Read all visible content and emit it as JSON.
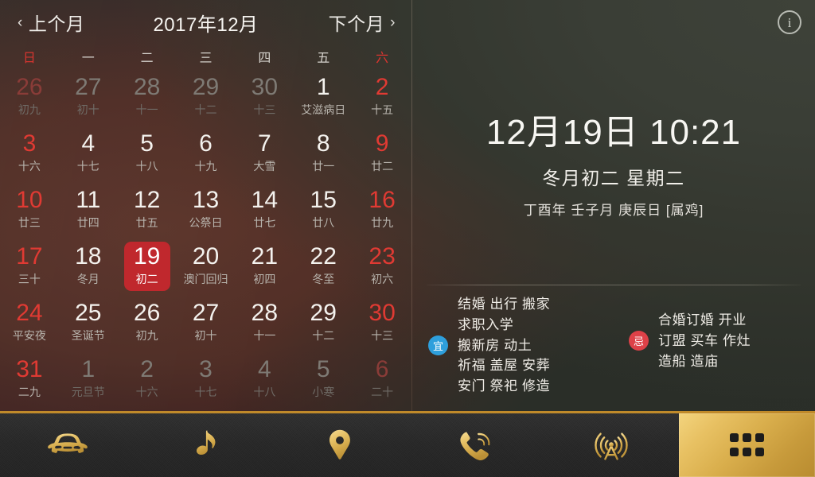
{
  "app": {
    "info_icon_glyph": "i",
    "accent_gold": "#d9ae4c",
    "selected_red": "#c0282d",
    "weekend_red": "#e03a33"
  },
  "calendar": {
    "prev_label": "上个月",
    "next_label": "下个月",
    "prev_chevron": "‹",
    "next_chevron": "›",
    "title": "2017年12月",
    "weekdays": [
      {
        "label": "日",
        "weekend": true
      },
      {
        "label": "一",
        "weekend": false
      },
      {
        "label": "二",
        "weekend": false
      },
      {
        "label": "三",
        "weekend": false
      },
      {
        "label": "四",
        "weekend": false
      },
      {
        "label": "五",
        "weekend": false
      },
      {
        "label": "六",
        "weekend": true
      }
    ],
    "weeks": [
      [
        {
          "num": "26",
          "sub": "初九",
          "out": true,
          "weekend": true,
          "selected": false
        },
        {
          "num": "27",
          "sub": "初十",
          "out": true,
          "weekend": false,
          "selected": false
        },
        {
          "num": "28",
          "sub": "十一",
          "out": true,
          "weekend": false,
          "selected": false
        },
        {
          "num": "29",
          "sub": "十二",
          "out": true,
          "weekend": false,
          "selected": false
        },
        {
          "num": "30",
          "sub": "十三",
          "out": true,
          "weekend": false,
          "selected": false
        },
        {
          "num": "1",
          "sub": "艾滋病日",
          "out": false,
          "weekend": false,
          "selected": false
        },
        {
          "num": "2",
          "sub": "十五",
          "out": false,
          "weekend": true,
          "selected": false
        }
      ],
      [
        {
          "num": "3",
          "sub": "十六",
          "out": false,
          "weekend": true,
          "selected": false
        },
        {
          "num": "4",
          "sub": "十七",
          "out": false,
          "weekend": false,
          "selected": false
        },
        {
          "num": "5",
          "sub": "十八",
          "out": false,
          "weekend": false,
          "selected": false
        },
        {
          "num": "6",
          "sub": "十九",
          "out": false,
          "weekend": false,
          "selected": false
        },
        {
          "num": "7",
          "sub": "大雪",
          "out": false,
          "weekend": false,
          "selected": false
        },
        {
          "num": "8",
          "sub": "廿一",
          "out": false,
          "weekend": false,
          "selected": false
        },
        {
          "num": "9",
          "sub": "廿二",
          "out": false,
          "weekend": true,
          "selected": false
        }
      ],
      [
        {
          "num": "10",
          "sub": "廿三",
          "out": false,
          "weekend": true,
          "selected": false
        },
        {
          "num": "11",
          "sub": "廿四",
          "out": false,
          "weekend": false,
          "selected": false
        },
        {
          "num": "12",
          "sub": "廿五",
          "out": false,
          "weekend": false,
          "selected": false
        },
        {
          "num": "13",
          "sub": "公祭日",
          "out": false,
          "weekend": false,
          "selected": false
        },
        {
          "num": "14",
          "sub": "廿七",
          "out": false,
          "weekend": false,
          "selected": false
        },
        {
          "num": "15",
          "sub": "廿八",
          "out": false,
          "weekend": false,
          "selected": false
        },
        {
          "num": "16",
          "sub": "廿九",
          "out": false,
          "weekend": true,
          "selected": false
        }
      ],
      [
        {
          "num": "17",
          "sub": "三十",
          "out": false,
          "weekend": true,
          "selected": false
        },
        {
          "num": "18",
          "sub": "冬月",
          "out": false,
          "weekend": false,
          "selected": false
        },
        {
          "num": "19",
          "sub": "初二",
          "out": false,
          "weekend": false,
          "selected": true
        },
        {
          "num": "20",
          "sub": "澳门回归",
          "out": false,
          "weekend": false,
          "selected": false
        },
        {
          "num": "21",
          "sub": "初四",
          "out": false,
          "weekend": false,
          "selected": false
        },
        {
          "num": "22",
          "sub": "冬至",
          "out": false,
          "weekend": false,
          "selected": false
        },
        {
          "num": "23",
          "sub": "初六",
          "out": false,
          "weekend": true,
          "selected": false
        }
      ],
      [
        {
          "num": "24",
          "sub": "平安夜",
          "out": false,
          "weekend": true,
          "selected": false
        },
        {
          "num": "25",
          "sub": "圣诞节",
          "out": false,
          "weekend": false,
          "selected": false
        },
        {
          "num": "26",
          "sub": "初九",
          "out": false,
          "weekend": false,
          "selected": false
        },
        {
          "num": "27",
          "sub": "初十",
          "out": false,
          "weekend": false,
          "selected": false
        },
        {
          "num": "28",
          "sub": "十一",
          "out": false,
          "weekend": false,
          "selected": false
        },
        {
          "num": "29",
          "sub": "十二",
          "out": false,
          "weekend": false,
          "selected": false
        },
        {
          "num": "30",
          "sub": "十三",
          "out": false,
          "weekend": true,
          "selected": false
        }
      ],
      [
        {
          "num": "31",
          "sub": "二九",
          "out": false,
          "weekend": true,
          "selected": false
        },
        {
          "num": "1",
          "sub": "元旦节",
          "out": true,
          "weekend": false,
          "selected": false
        },
        {
          "num": "2",
          "sub": "十六",
          "out": true,
          "weekend": false,
          "selected": false
        },
        {
          "num": "3",
          "sub": "十七",
          "out": true,
          "weekend": false,
          "selected": false
        },
        {
          "num": "4",
          "sub": "十八",
          "out": true,
          "weekend": false,
          "selected": false
        },
        {
          "num": "5",
          "sub": "小寒",
          "out": true,
          "weekend": false,
          "selected": false
        },
        {
          "num": "6",
          "sub": "二十",
          "out": true,
          "weekend": true,
          "selected": false
        }
      ]
    ]
  },
  "detail": {
    "big_date": "12月19日 10:21",
    "lunar": "冬月初二  星期二",
    "ganzhi": "丁酉年  壬子月  庚辰日  [属鸡]",
    "yi": {
      "badge": "宜",
      "lines": [
        "结婚 出行 搬家",
        "求职入学",
        "搬新房 动土",
        "祈福 盖屋 安葬",
        "安门 祭祀 修造"
      ]
    },
    "ji": {
      "badge": "忌",
      "lines": [
        "合婚订婚 开业",
        "订盟 买车 作灶",
        "造船 造庙"
      ]
    }
  },
  "dock": {
    "items": [
      {
        "icon": "car-icon",
        "active": false
      },
      {
        "icon": "music-note-icon",
        "active": false
      },
      {
        "icon": "location-pin-icon",
        "active": false
      },
      {
        "icon": "phone-icon",
        "active": false
      },
      {
        "icon": "radio-tower-icon",
        "active": false
      },
      {
        "icon": "app-grid-icon",
        "active": true
      }
    ]
  }
}
